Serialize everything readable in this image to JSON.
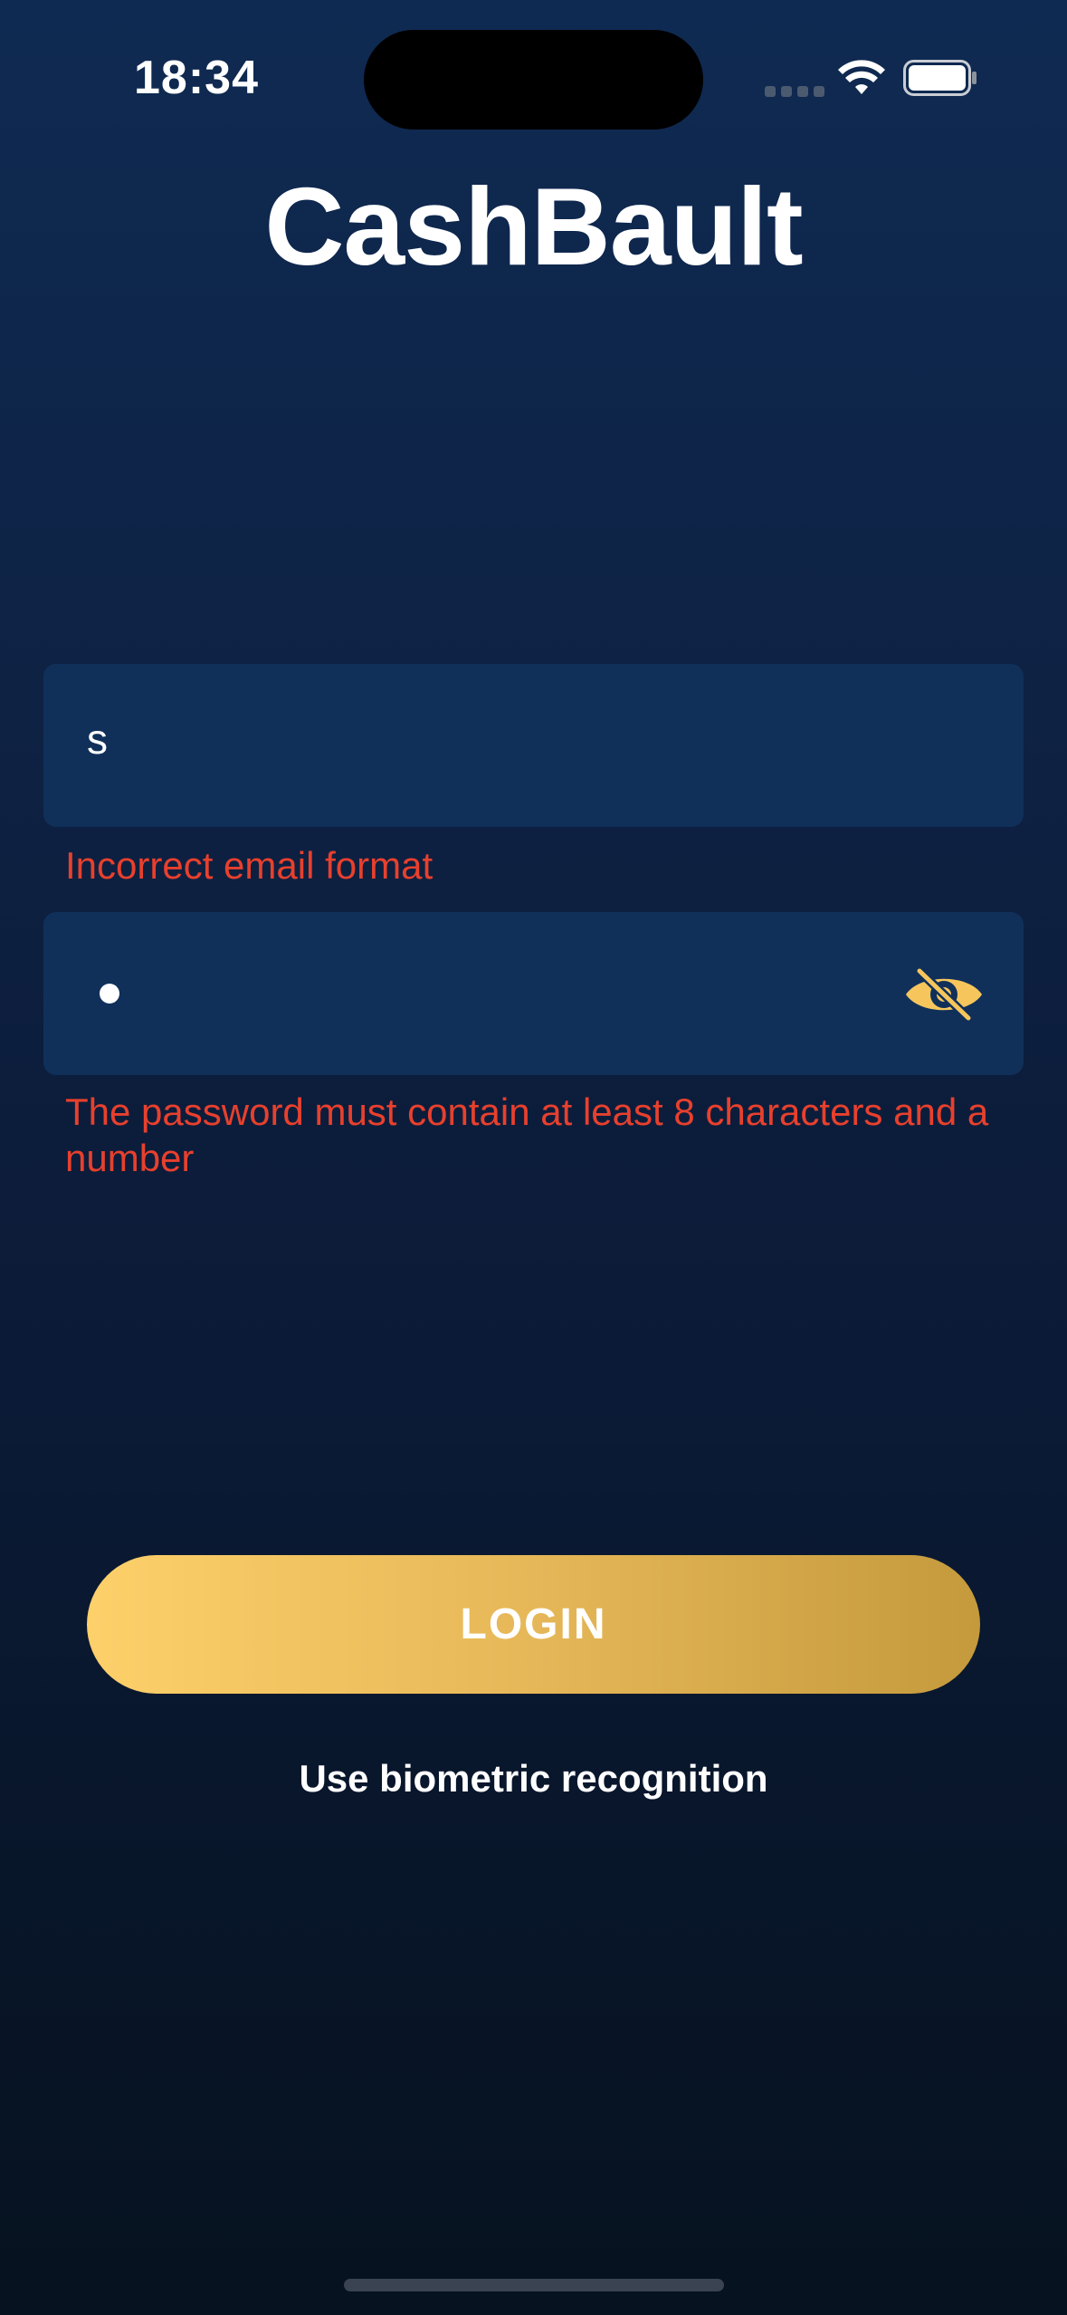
{
  "status_bar": {
    "time": "18:34",
    "signal_icon": "signal-dots-icon",
    "wifi_icon": "wifi-icon",
    "battery_icon": "battery-icon"
  },
  "app": {
    "title": "CashBault"
  },
  "email": {
    "value": "s",
    "error": "Incorrect email format"
  },
  "password": {
    "masked_chars": 1,
    "visibility_icon": "eye-slash-icon",
    "error": "The password must contain at least 8 characters and a number"
  },
  "actions": {
    "login_label": "LOGIN",
    "biometric_label": "Use biometric recognition"
  },
  "colors": {
    "background_top": "#0f2a52",
    "background_bottom": "#06121f",
    "field_bg": "#10305a",
    "error": "#e8402d",
    "accent_gold_start": "#fdd06a",
    "accent_gold_end": "#c49a3c"
  }
}
